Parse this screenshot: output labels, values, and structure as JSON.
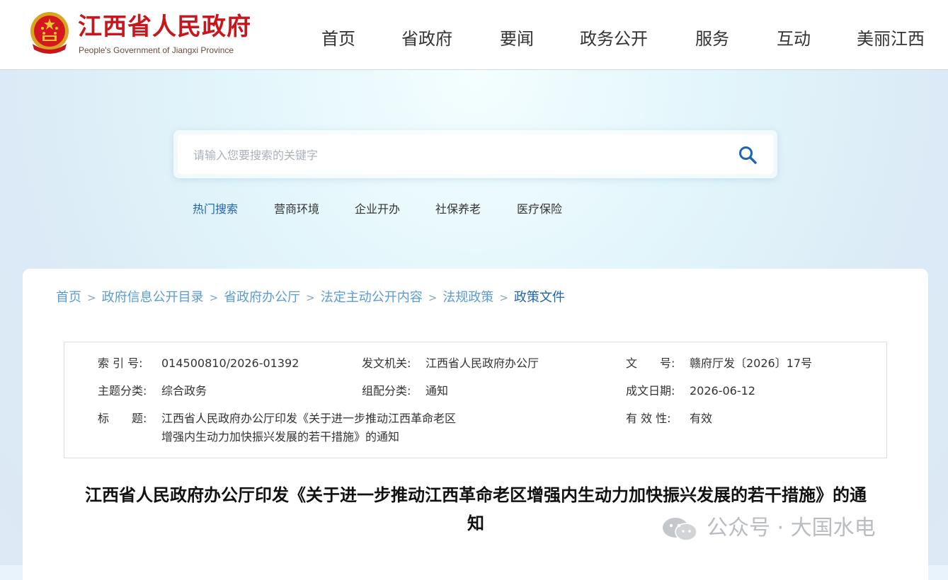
{
  "header": {
    "logo_cn": "江西省人民政府",
    "logo_en": "People's Government of Jiangxi Province",
    "nav": [
      {
        "label": "首页"
      },
      {
        "label": "省政府"
      },
      {
        "label": "要闻"
      },
      {
        "label": "政务公开"
      },
      {
        "label": "服务"
      },
      {
        "label": "互动"
      },
      {
        "label": "美丽江西"
      }
    ]
  },
  "search": {
    "placeholder": "请输入您要搜索的关键字",
    "value": ""
  },
  "hot_search": {
    "label": "热门搜索",
    "items": [
      "营商环境",
      "企业开办",
      "社保养老",
      "医疗保险"
    ]
  },
  "breadcrumb": {
    "items": [
      "首页",
      "政府信息公开目录",
      "省政府办公厅",
      "法定主动公开内容",
      "法规政策"
    ],
    "separator": ">",
    "current": "政策文件"
  },
  "meta": {
    "index_label": "索 引 号:",
    "index_value": "014500810/2026-01392",
    "issuer_label": "发文机关:",
    "issuer_value": "江西省人民政府办公厅",
    "doc_no_label": "文　　号:",
    "doc_no_value": "赣府厅发〔2026〕17号",
    "topic_label": "主题分类:",
    "topic_value": "综合政务",
    "genre_label": "组配分类:",
    "genre_value": "通知",
    "date_label": "成文日期:",
    "date_value": "2026-06-12",
    "title_label": "标　　题:",
    "title_value_line1": "江西省人民政府办公厅印发《关于进一步推动江西革命老区",
    "title_value_line2": "增强内生动力加快振兴发展的若干措施》的通知",
    "validity_label": "有 效 性:",
    "validity_value": "有效"
  },
  "document": {
    "title_line1": "江西省人民政府办公厅印发《关于进一步推动江西革命老区增强内生动力加快振兴发展的若干措施》的通",
    "title_line2": "知"
  },
  "watermark": {
    "text": "公众号 · 大国水电"
  },
  "colors": {
    "brand_red": "#c8161d",
    "link_blue": "#1f64b3",
    "crumb_blue": "#5a9bd5"
  }
}
